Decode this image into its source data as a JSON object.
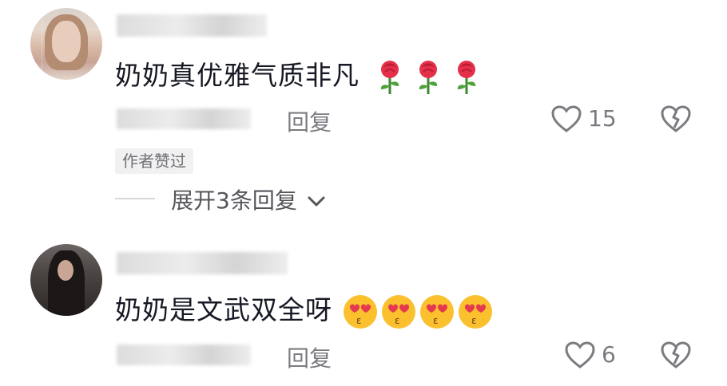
{
  "comments": [
    {
      "text": "奶奶真优雅气质非凡",
      "emoji": "rose",
      "emoji_count": 3,
      "reply_label": "回复",
      "likes": "15",
      "author_badge": "作者赞过",
      "expand_label": "展开3条回复"
    },
    {
      "text": "奶奶是文武双全呀",
      "emoji": "heart-eyes-kiss",
      "emoji_count": 4,
      "reply_label": "回复",
      "likes": "6"
    }
  ],
  "colors": {
    "text": "#161823",
    "meta": "#7a7b80",
    "badge_bg": "#f1f1f2"
  }
}
